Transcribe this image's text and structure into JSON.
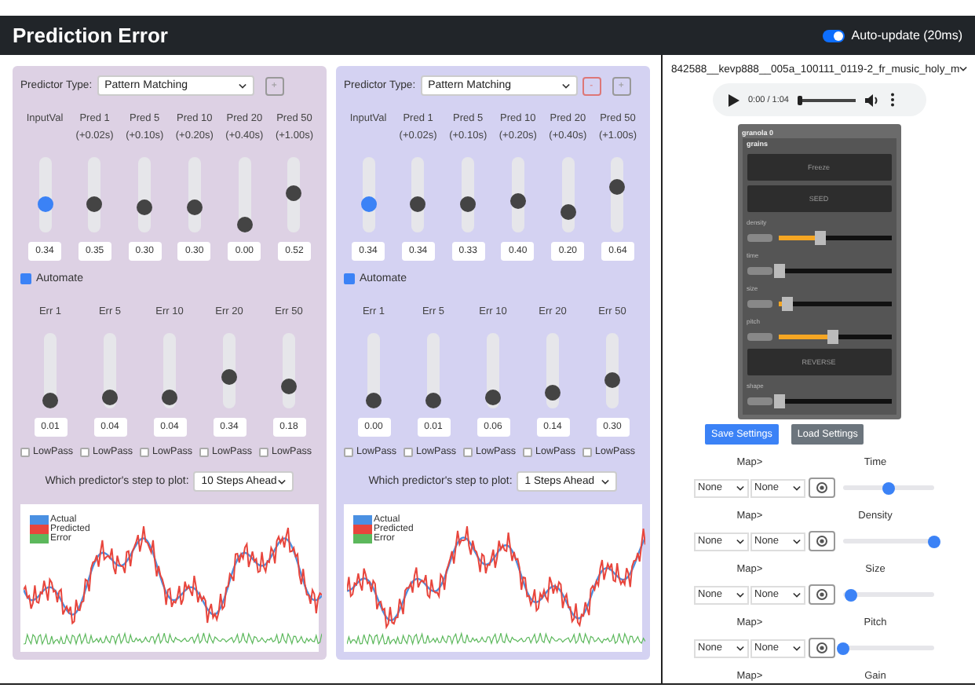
{
  "header": {
    "title": "Prediction Error",
    "auto_update": {
      "label": "Auto-update (20ms)",
      "on": true
    }
  },
  "panels": [
    {
      "color": "#ddd1e4",
      "predictor_label": "Predictor Type:",
      "predictor_type": "Pattern Matching",
      "buttons": [
        {
          "kind": "add",
          "label": "+"
        }
      ],
      "sliders": [
        {
          "kind": "input",
          "label": "InputVal",
          "value": "0.34",
          "level": 0.34
        },
        {
          "kind": "pred",
          "label": "Pred 1",
          "sublabel": "(+0.02s)",
          "value": "0.35",
          "level": 0.35
        },
        {
          "kind": "pred",
          "label": "Pred 5",
          "sublabel": "(+0.10s)",
          "value": "0.30",
          "level": 0.3
        },
        {
          "kind": "pred",
          "label": "Pred 10",
          "sublabel": "(+0.20s)",
          "value": "0.30",
          "level": 0.3
        },
        {
          "kind": "pred",
          "label": "Pred 20",
          "sublabel": "(+0.40s)",
          "value": "0.00",
          "level": 0.0
        },
        {
          "kind": "pred",
          "label": "Pred 50",
          "sublabel": "(+1.00s)",
          "value": "0.52",
          "level": 0.52
        }
      ],
      "automate": {
        "label": "Automate",
        "checked": true
      },
      "errors": [
        {
          "label": "Err 1",
          "value": "0.01",
          "level": 0.01
        },
        {
          "label": "Err 5",
          "value": "0.04",
          "level": 0.04
        },
        {
          "label": "Err 10",
          "value": "0.04",
          "level": 0.04
        },
        {
          "label": "Err 20",
          "value": "0.34",
          "level": 0.4
        },
        {
          "label": "Err 50",
          "value": "0.18",
          "level": 0.25
        }
      ],
      "lowpass": [
        {
          "label": "LowPass",
          "checked": false
        },
        {
          "label": "LowPass",
          "checked": false
        },
        {
          "label": "LowPass",
          "checked": false
        },
        {
          "label": "LowPass",
          "checked": false
        },
        {
          "label": "LowPass",
          "checked": false
        }
      ],
      "plot_label": "Which predictor's step to plot:",
      "plot_step": "10 Steps Ahead",
      "legend": [
        {
          "label": "Actual",
          "color": "#4a90e2"
        },
        {
          "label": "Predicted",
          "color": "#e8453c"
        },
        {
          "label": "Error",
          "color": "#5cb85c"
        }
      ]
    },
    {
      "color": "#d4d2f2",
      "predictor_label": "Predictor Type:",
      "predictor_type": "Pattern Matching",
      "buttons": [
        {
          "kind": "remove",
          "label": "-"
        },
        {
          "kind": "add",
          "label": "+"
        }
      ],
      "sliders": [
        {
          "kind": "input",
          "label": "InputVal",
          "value": "0.34",
          "level": 0.34
        },
        {
          "kind": "pred",
          "label": "Pred 1",
          "sublabel": "(+0.02s)",
          "value": "0.34",
          "level": 0.34
        },
        {
          "kind": "pred",
          "label": "Pred 5",
          "sublabel": "(+0.10s)",
          "value": "0.33",
          "level": 0.33
        },
        {
          "kind": "pred",
          "label": "Pred 10",
          "sublabel": "(+0.20s)",
          "value": "0.40",
          "level": 0.4
        },
        {
          "kind": "pred",
          "label": "Pred 20",
          "sublabel": "(+0.40s)",
          "value": "0.20",
          "level": 0.2
        },
        {
          "kind": "pred",
          "label": "Pred 50",
          "sublabel": "(+1.00s)",
          "value": "0.64",
          "level": 0.64
        }
      ],
      "automate": {
        "label": "Automate",
        "checked": true
      },
      "errors": [
        {
          "label": "Err 1",
          "value": "0.00",
          "level": 0.0
        },
        {
          "label": "Err 5",
          "value": "0.01",
          "level": 0.01
        },
        {
          "label": "Err 10",
          "value": "0.06",
          "level": 0.06
        },
        {
          "label": "Err 20",
          "value": "0.14",
          "level": 0.14
        },
        {
          "label": "Err 50",
          "value": "0.30",
          "level": 0.35
        }
      ],
      "lowpass": [
        {
          "label": "LowPass",
          "checked": false
        },
        {
          "label": "LowPass",
          "checked": false
        },
        {
          "label": "LowPass",
          "checked": false
        },
        {
          "label": "LowPass",
          "checked": false
        },
        {
          "label": "LowPass",
          "checked": false
        }
      ],
      "plot_label": "Which predictor's step to plot:",
      "plot_step": "1 Steps Ahead",
      "legend": [
        {
          "label": "Actual",
          "color": "#4a90e2"
        },
        {
          "label": "Predicted",
          "color": "#e8453c"
        },
        {
          "label": "Error",
          "color": "#5cb85c"
        }
      ]
    }
  ],
  "sidebar": {
    "file": "842588__kevp888__005a_100111_0119-2_fr_music_holy_m",
    "audio": {
      "time": "0:00 / 1:04",
      "level": 0.0
    },
    "granola": {
      "title": "granola 0",
      "section": "grains",
      "items": [
        {
          "kind": "button",
          "label": "Freeze"
        },
        {
          "kind": "button",
          "label": "SEED"
        },
        {
          "kind": "param",
          "label": "density",
          "level": 0.4
        },
        {
          "kind": "param",
          "label": "time",
          "level": 0.03
        },
        {
          "kind": "param",
          "label": "size",
          "level": 0.1
        },
        {
          "kind": "param",
          "label": "pitch",
          "level": 0.5
        },
        {
          "kind": "button",
          "label": "REVERSE"
        },
        {
          "kind": "param",
          "label": "shape",
          "level": 0.03
        }
      ]
    },
    "buttons": [
      {
        "kind": "primary",
        "label": "Save Settings"
      },
      {
        "kind": "secondary",
        "label": "Load Settings"
      }
    ],
    "mappings": [
      {
        "map_label": "Map>",
        "source": "None",
        "target": "None",
        "name": "Time",
        "level": 0.5
      },
      {
        "map_label": "Map>",
        "source": "None",
        "target": "None",
        "name": "Density",
        "level": 1.0
      },
      {
        "map_label": "Map>",
        "source": "None",
        "target": "None",
        "name": "Size",
        "level": 0.1
      },
      {
        "map_label": "Map>",
        "source": "None",
        "target": "None",
        "name": "Pitch",
        "level": 0.0
      },
      {
        "map_label": "Map>",
        "name": "Gain"
      }
    ]
  }
}
